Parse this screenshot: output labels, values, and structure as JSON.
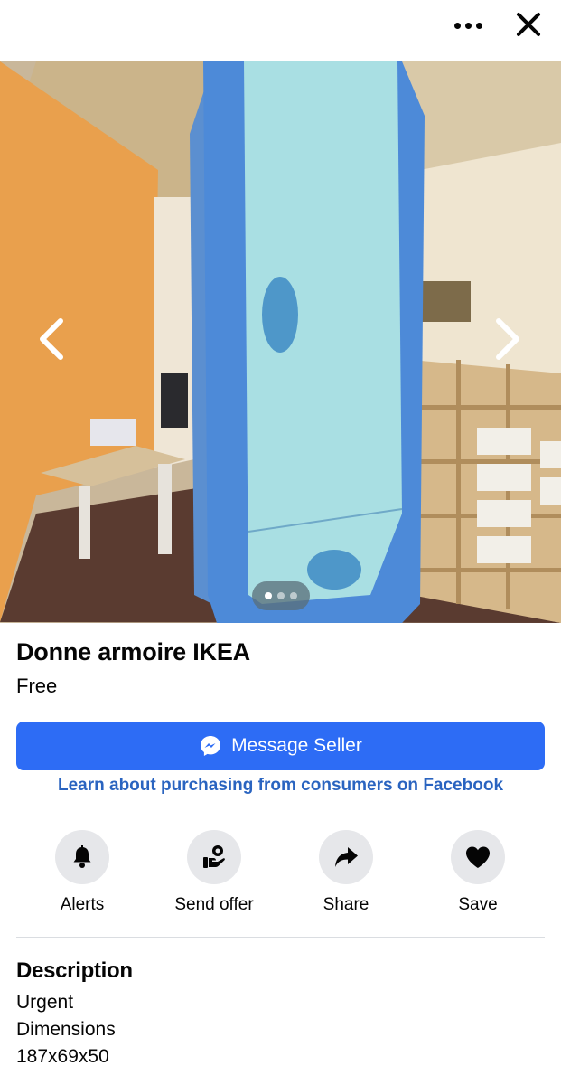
{
  "header": {
    "more_icon": "ellipsis-icon",
    "close_icon": "close-icon"
  },
  "photo": {
    "image_count": 3,
    "active_index": 0,
    "prev_icon": "chevron-left-icon",
    "next_icon": "chevron-right-icon"
  },
  "listing": {
    "title": "Donne armoire IKEA",
    "price": "Free"
  },
  "message_button": {
    "label": "Message Seller",
    "icon": "messenger-icon",
    "color": "#2d6cf5"
  },
  "learn_link": {
    "label": "Learn about purchasing from consumers on Facebook",
    "color": "#2a64c0"
  },
  "actions": [
    {
      "label": "Alerts",
      "icon": "bell-icon"
    },
    {
      "label": "Send offer",
      "icon": "send-offer-icon"
    },
    {
      "label": "Share",
      "icon": "share-arrow-icon"
    },
    {
      "label": "Save",
      "icon": "heart-icon"
    }
  ],
  "description": {
    "heading": "Description",
    "lines": [
      "Urgent",
      "Dimensions",
      "187x69x50"
    ]
  }
}
